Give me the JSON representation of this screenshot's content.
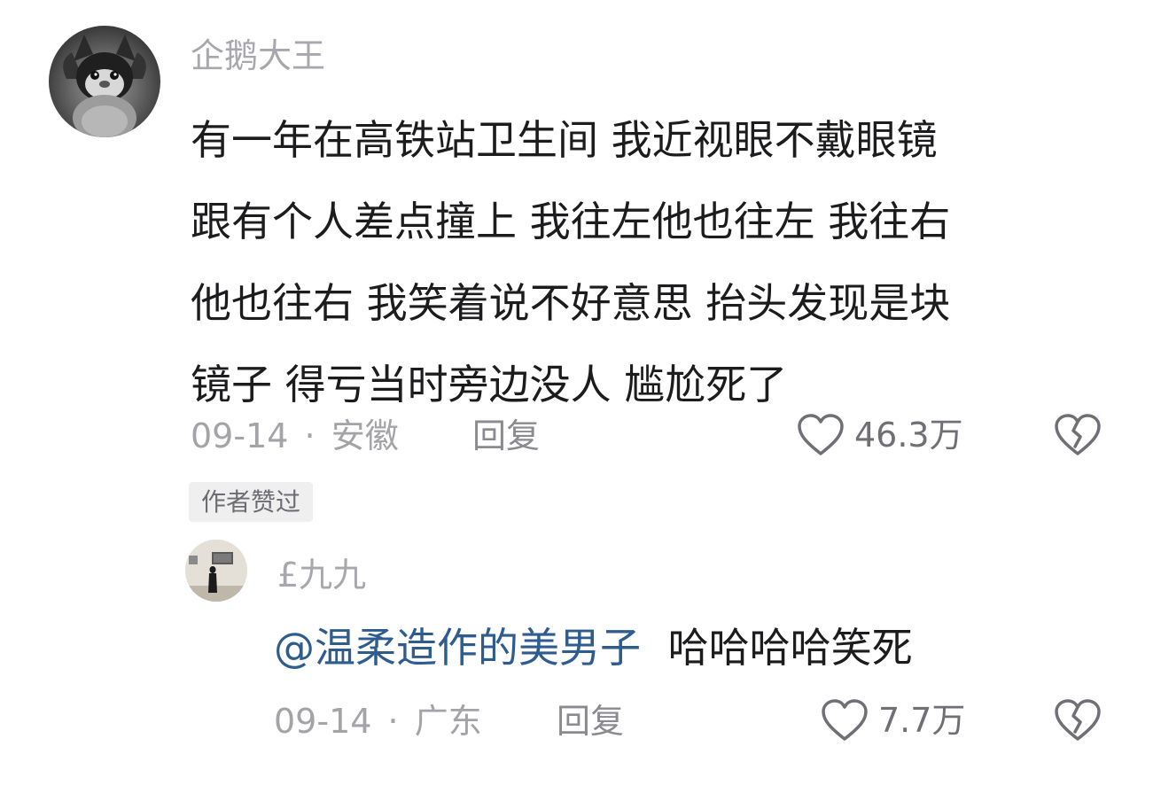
{
  "comment": {
    "username": "企鹅大王",
    "lines": [
      "有一年在高铁站卫生间 我近视眼不戴眼镜",
      "跟有个人差点撞上 我往左他也往左 我往右",
      "他也往右 我笑着说不好意思 抬头发现是块",
      "镜子 得亏当时旁边没人 尴尬死了"
    ],
    "date": "09-14",
    "separator": "·",
    "location": "安徽",
    "reply_label": "回复",
    "like_count": "46.3万",
    "badge": "作者赞过"
  },
  "reply": {
    "username": "£九九",
    "mention": "@温柔造作的美男子",
    "text": "哈哈哈哈笑死",
    "date": "09-14",
    "separator": "·",
    "location": "广东",
    "reply_label": "回复",
    "like_count": "7.7万"
  },
  "colors": {
    "mention": "#2e5c8e",
    "username": "#a7a7ad",
    "body_text": "#1c1c1e",
    "meta": "#a3a3a8"
  },
  "icons": {
    "like": "heart-outline-icon",
    "dislike": "broken-heart-icon"
  }
}
